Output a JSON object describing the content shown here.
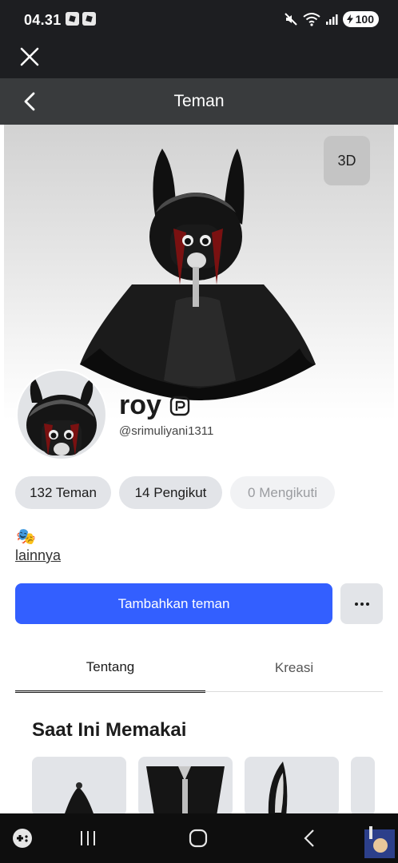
{
  "status_bar": {
    "time": "04.31",
    "battery": "100"
  },
  "header": {
    "title": "Teman"
  },
  "hero": {
    "view_3d_label": "3D"
  },
  "profile": {
    "display_name": "roy",
    "username": "@srimuliyani1311",
    "stats": {
      "friends": "132 Teman",
      "followers": "14 Pengikut",
      "following": "0 Mengikuti"
    },
    "bio_emoji": "🎭",
    "more_link": "lainnya"
  },
  "actions": {
    "add_friend": "Tambahkan teman"
  },
  "tabs": {
    "about": "Tentang",
    "creations": "Kreasi"
  },
  "wearing": {
    "title": "Saat Ini Memakai"
  },
  "colors": {
    "accent": "#335fff",
    "nav_dark": "#393b3d",
    "status_dark": "#1d1e21"
  }
}
